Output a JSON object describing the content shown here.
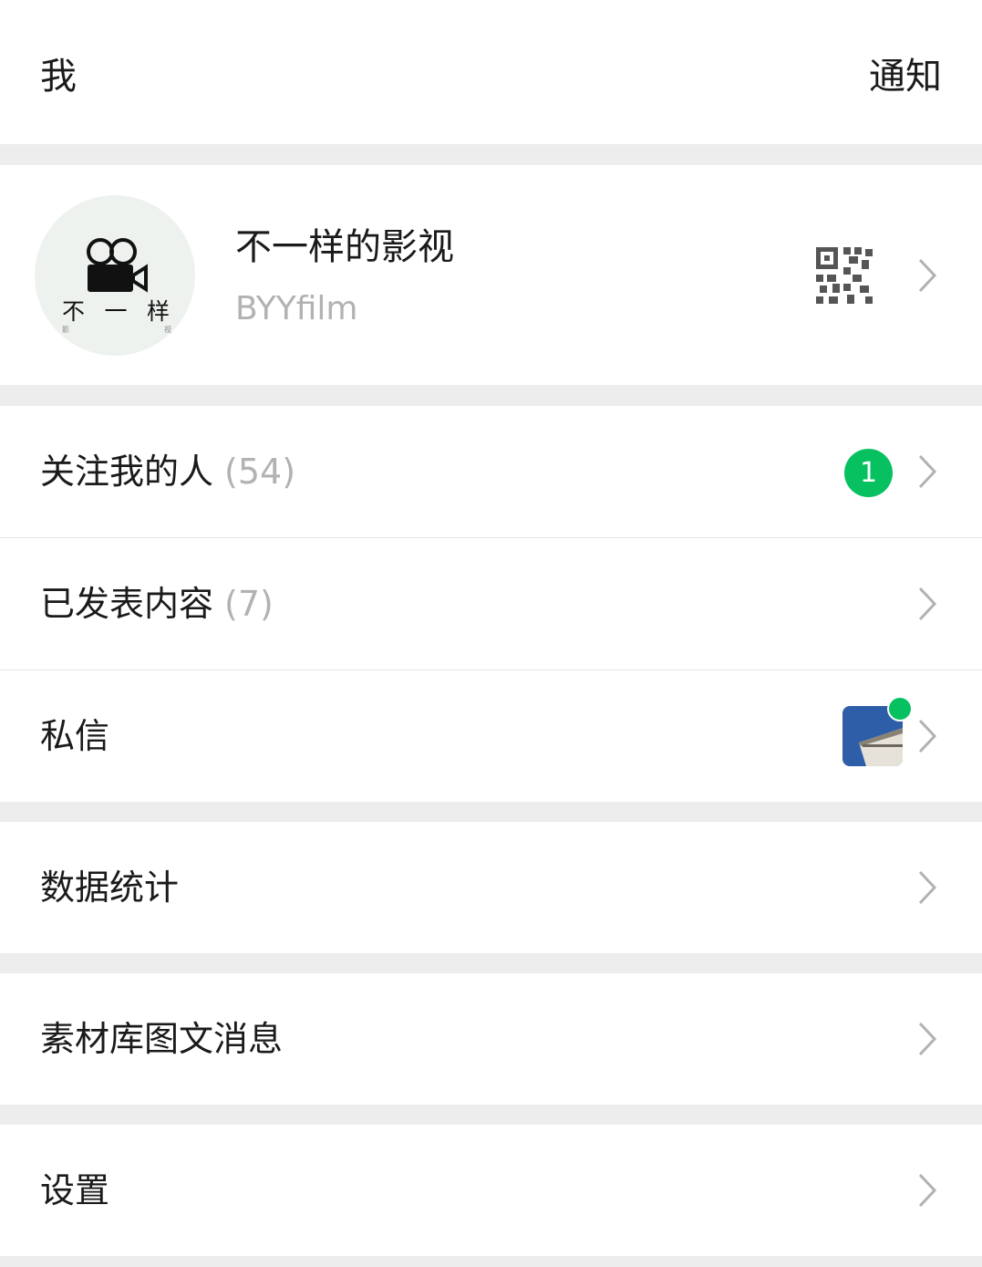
{
  "header": {
    "title": "我",
    "notify_label": "通知"
  },
  "profile": {
    "name": "不一样的影视",
    "handle": "BYYfilm",
    "avatar_logo_chars": [
      "不",
      "一",
      "样"
    ],
    "avatar_logo_sub": [
      "影",
      "视"
    ]
  },
  "menu": {
    "followers": {
      "label": "关注我的人",
      "count": "(54)",
      "badge": "1"
    },
    "published": {
      "label": "已发表内容",
      "count": "(7)"
    },
    "messages": {
      "label": "私信"
    },
    "stats": {
      "label": "数据统计"
    },
    "materials": {
      "label": "素材库图文消息"
    },
    "settings": {
      "label": "设置"
    }
  },
  "colors": {
    "accent": "#07c160",
    "muted_text": "#b2b2b2",
    "background": "#ededed"
  },
  "icons": [
    "qr-code-icon",
    "chevron-right-icon",
    "movie-camera-icon"
  ]
}
